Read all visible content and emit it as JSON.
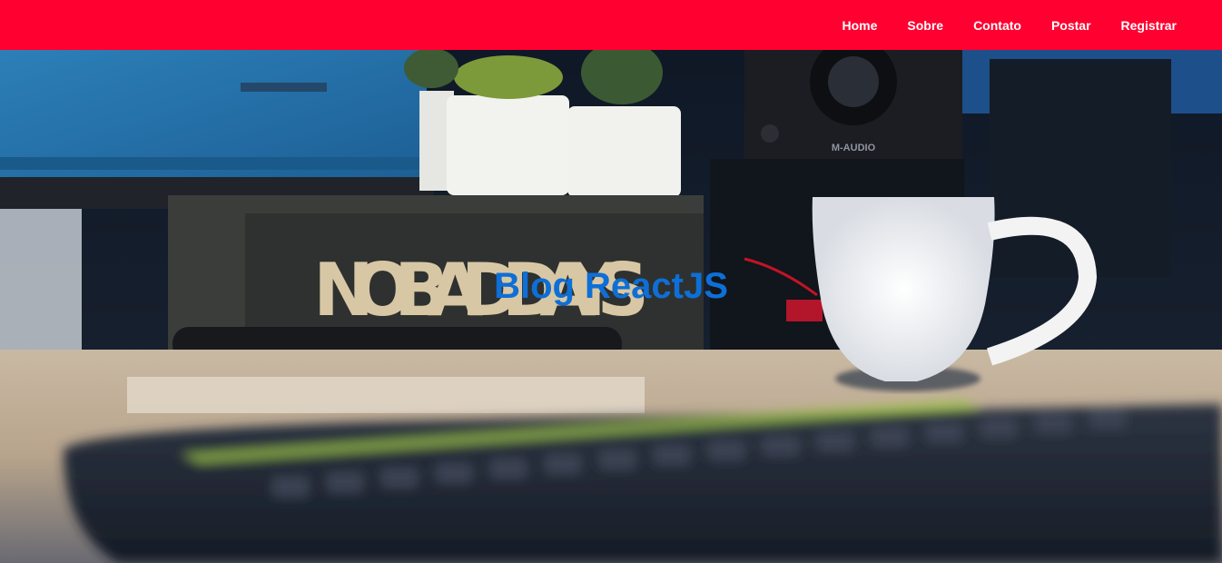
{
  "nav": {
    "links": [
      {
        "label": "Home"
      },
      {
        "label": "Sobre"
      },
      {
        "label": "Contato"
      },
      {
        "label": "Postar"
      },
      {
        "label": "Registrar"
      }
    ]
  },
  "hero": {
    "title": "Blog ReactJS",
    "sign_text": "NO BAD DAYS",
    "speaker_brand": "M-AUDIO"
  },
  "colors": {
    "navbar": "#ff0030",
    "title": "#0e6fd6"
  }
}
